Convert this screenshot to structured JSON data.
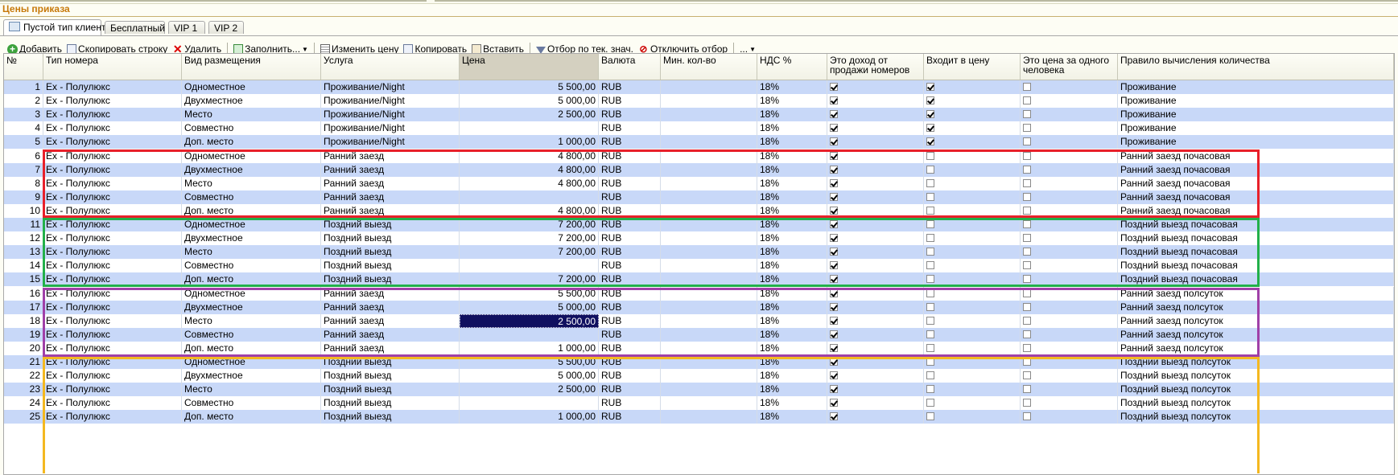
{
  "form": {
    "title": "Цены приказа"
  },
  "tabs": [
    {
      "label": "Пустой тип клиента",
      "active": true
    },
    {
      "label": "Бесплатный",
      "active": false
    },
    {
      "label": "VIP 1",
      "active": false
    },
    {
      "label": "VIP 2",
      "active": false
    }
  ],
  "toolbar": {
    "add": "Добавить",
    "copy_row": "Скопировать строку",
    "delete": "Удалить",
    "fill": "Заполнить...",
    "change_price": "Изменить цену",
    "copy": "Копировать",
    "paste": "Вставить",
    "filter": "Отбор по тек. знач.",
    "unfilter": "Отключить отбор",
    "more": "..."
  },
  "columns": {
    "num": "№",
    "room_type": "Тип номера",
    "accommodation": "Вид размещения",
    "service": "Услуга",
    "price": "Цена",
    "currency": "Валюта",
    "min_qty": "Мин. кол-во",
    "vat": "НДС %",
    "room_revenue": "Это доход от продажи номеров",
    "in_price": "Входит в цену",
    "per_person": "Это цена за одного человека",
    "qty_rule": "Правило вычисления количества"
  },
  "rows": [
    {
      "n": "1",
      "room": "Ex - Полулюкс",
      "acc": "Одноместное",
      "svc": "Проживание/Night",
      "price": "5 500,00",
      "cur": "RUB",
      "min": "",
      "vat": "18%",
      "rev": true,
      "inp": true,
      "pp": false,
      "rule": "Проживание"
    },
    {
      "n": "2",
      "room": "Ex - Полулюкс",
      "acc": "Двухместное",
      "svc": "Проживание/Night",
      "price": "5 000,00",
      "cur": "RUB",
      "min": "",
      "vat": "18%",
      "rev": true,
      "inp": true,
      "pp": false,
      "rule": "Проживание"
    },
    {
      "n": "3",
      "room": "Ex - Полулюкс",
      "acc": "Место",
      "svc": "Проживание/Night",
      "price": "2 500,00",
      "cur": "RUB",
      "min": "",
      "vat": "18%",
      "rev": true,
      "inp": true,
      "pp": false,
      "rule": "Проживание"
    },
    {
      "n": "4",
      "room": "Ex - Полулюкс",
      "acc": "Совместно",
      "svc": "Проживание/Night",
      "price": "",
      "cur": "RUB",
      "min": "",
      "vat": "18%",
      "rev": true,
      "inp": true,
      "pp": false,
      "rule": "Проживание"
    },
    {
      "n": "5",
      "room": "Ex - Полулюкс",
      "acc": "Доп. место",
      "svc": "Проживание/Night",
      "price": "1 000,00",
      "cur": "RUB",
      "min": "",
      "vat": "18%",
      "rev": true,
      "inp": true,
      "pp": false,
      "rule": "Проживание"
    },
    {
      "n": "6",
      "room": "Ex - Полулюкс",
      "acc": "Одноместное",
      "svc": "Ранний заезд",
      "price": "4 800,00",
      "cur": "RUB",
      "min": "",
      "vat": "18%",
      "rev": true,
      "inp": false,
      "pp": false,
      "rule": "Ранний заезд почасовая"
    },
    {
      "n": "7",
      "room": "Ex - Полулюкс",
      "acc": "Двухместное",
      "svc": "Ранний заезд",
      "price": "4 800,00",
      "cur": "RUB",
      "min": "",
      "vat": "18%",
      "rev": true,
      "inp": false,
      "pp": false,
      "rule": "Ранний заезд почасовая"
    },
    {
      "n": "8",
      "room": "Ex - Полулюкс",
      "acc": "Место",
      "svc": "Ранний заезд",
      "price": "4 800,00",
      "cur": "RUB",
      "min": "",
      "vat": "18%",
      "rev": true,
      "inp": false,
      "pp": false,
      "rule": "Ранний заезд почасовая"
    },
    {
      "n": "9",
      "room": "Ex - Полулюкс",
      "acc": "Совместно",
      "svc": "Ранний заезд",
      "price": "",
      "cur": "RUB",
      "min": "",
      "vat": "18%",
      "rev": true,
      "inp": false,
      "pp": false,
      "rule": "Ранний заезд почасовая"
    },
    {
      "n": "10",
      "room": "Ex - Полулюкс",
      "acc": "Доп. место",
      "svc": "Ранний заезд",
      "price": "4 800,00",
      "cur": "RUB",
      "min": "",
      "vat": "18%",
      "rev": true,
      "inp": false,
      "pp": false,
      "rule": "Ранний заезд почасовая"
    },
    {
      "n": "11",
      "room": "Ex - Полулюкс",
      "acc": "Одноместное",
      "svc": "Поздний выезд",
      "price": "7 200,00",
      "cur": "RUB",
      "min": "",
      "vat": "18%",
      "rev": true,
      "inp": false,
      "pp": false,
      "rule": "Поздний выезд почасовая"
    },
    {
      "n": "12",
      "room": "Ex - Полулюкс",
      "acc": "Двухместное",
      "svc": "Поздний выезд",
      "price": "7 200,00",
      "cur": "RUB",
      "min": "",
      "vat": "18%",
      "rev": true,
      "inp": false,
      "pp": false,
      "rule": "Поздний выезд почасовая"
    },
    {
      "n": "13",
      "room": "Ex - Полулюкс",
      "acc": "Место",
      "svc": "Поздний выезд",
      "price": "7 200,00",
      "cur": "RUB",
      "min": "",
      "vat": "18%",
      "rev": true,
      "inp": false,
      "pp": false,
      "rule": "Поздний выезд почасовая"
    },
    {
      "n": "14",
      "room": "Ex - Полулюкс",
      "acc": "Совместно",
      "svc": "Поздний выезд",
      "price": "",
      "cur": "RUB",
      "min": "",
      "vat": "18%",
      "rev": true,
      "inp": false,
      "pp": false,
      "rule": "Поздний выезд почасовая"
    },
    {
      "n": "15",
      "room": "Ex - Полулюкс",
      "acc": "Доп. место",
      "svc": "Поздний выезд",
      "price": "7 200,00",
      "cur": "RUB",
      "min": "",
      "vat": "18%",
      "rev": true,
      "inp": false,
      "pp": false,
      "rule": "Поздний выезд почасовая"
    },
    {
      "n": "16",
      "room": "Ex - Полулюкс",
      "acc": "Одноместное",
      "svc": "Ранний заезд",
      "price": "5 500,00",
      "cur": "RUB",
      "min": "",
      "vat": "18%",
      "rev": true,
      "inp": false,
      "pp": false,
      "rule": "Ранний заезд полсуток"
    },
    {
      "n": "17",
      "room": "Ex - Полулюкс",
      "acc": "Двухместное",
      "svc": "Ранний заезд",
      "price": "5 000,00",
      "cur": "RUB",
      "min": "",
      "vat": "18%",
      "rev": true,
      "inp": false,
      "pp": false,
      "rule": "Ранний заезд полсуток"
    },
    {
      "n": "18",
      "room": "Ex - Полулюкс",
      "acc": "Место",
      "svc": "Ранний заезд",
      "price": "2 500,00",
      "cur": "RUB",
      "min": "",
      "vat": "18%",
      "rev": true,
      "inp": false,
      "pp": false,
      "rule": "Ранний заезд полсуток",
      "selected": true
    },
    {
      "n": "19",
      "room": "Ex - Полулюкс",
      "acc": "Совместно",
      "svc": "Ранний заезд",
      "price": "",
      "cur": "RUB",
      "min": "",
      "vat": "18%",
      "rev": true,
      "inp": false,
      "pp": false,
      "rule": "Ранний заезд полсуток"
    },
    {
      "n": "20",
      "room": "Ex - Полулюкс",
      "acc": "Доп. место",
      "svc": "Ранний заезд",
      "price": "1 000,00",
      "cur": "RUB",
      "min": "",
      "vat": "18%",
      "rev": true,
      "inp": false,
      "pp": false,
      "rule": "Ранний заезд полсуток"
    },
    {
      "n": "21",
      "room": "Ex - Полулюкс",
      "acc": "Одноместное",
      "svc": "Поздний выезд",
      "price": "5 500,00",
      "cur": "RUB",
      "min": "",
      "vat": "18%",
      "rev": true,
      "inp": false,
      "pp": false,
      "rule": "Поздний выезд полсуток"
    },
    {
      "n": "22",
      "room": "Ex - Полулюкс",
      "acc": "Двухместное",
      "svc": "Поздний выезд",
      "price": "5 000,00",
      "cur": "RUB",
      "min": "",
      "vat": "18%",
      "rev": true,
      "inp": false,
      "pp": false,
      "rule": "Поздний выезд полсуток"
    },
    {
      "n": "23",
      "room": "Ex - Полулюкс",
      "acc": "Место",
      "svc": "Поздний выезд",
      "price": "2 500,00",
      "cur": "RUB",
      "min": "",
      "vat": "18%",
      "rev": true,
      "inp": false,
      "pp": false,
      "rule": "Поздний выезд полсуток"
    },
    {
      "n": "24",
      "room": "Ex - Полулюкс",
      "acc": "Совместно",
      "svc": "Поздний выезд",
      "price": "",
      "cur": "RUB",
      "min": "",
      "vat": "18%",
      "rev": true,
      "inp": false,
      "pp": false,
      "rule": "Поздний выезд полсуток"
    },
    {
      "n": "25",
      "room": "Ex - Полулюкс",
      "acc": "Доп. место",
      "svc": "Поздний выезд",
      "price": "1 000,00",
      "cur": "RUB",
      "min": "",
      "vat": "18%",
      "rev": true,
      "inp": false,
      "pp": false,
      "rule": "Поздний выезд полсуток"
    }
  ],
  "highlight_colors": [
    "#e8202a",
    "#22b04a",
    "#a040a8",
    "#f4b820"
  ],
  "selected_cell_color": "#101060",
  "row_alt_color": "#c8d8f8",
  "title_color": "#c7790a"
}
